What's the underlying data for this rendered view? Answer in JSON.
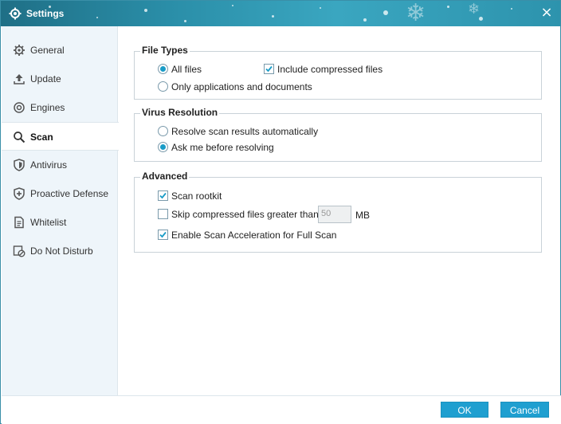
{
  "window": {
    "title": "Settings",
    "close_label": "×"
  },
  "sidebar": {
    "items": [
      {
        "label": "General",
        "icon": "gear-icon",
        "active": false
      },
      {
        "label": "Update",
        "icon": "upload-icon",
        "active": false
      },
      {
        "label": "Engines",
        "icon": "engine-icon",
        "active": false
      },
      {
        "label": "Scan",
        "icon": "search-icon",
        "active": true
      },
      {
        "label": "Antivirus",
        "icon": "shield-icon",
        "active": false
      },
      {
        "label": "Proactive Defense",
        "icon": "shield-plus-icon",
        "active": false
      },
      {
        "label": "Whitelist",
        "icon": "document-icon",
        "active": false
      },
      {
        "label": "Do Not Disturb",
        "icon": "do-not-disturb-icon",
        "active": false
      }
    ]
  },
  "file_types": {
    "title": "File Types",
    "all_files": {
      "label": "All files",
      "selected": true
    },
    "include_compressed": {
      "label": "Include compressed files",
      "checked": true
    },
    "apps_docs": {
      "label": "Only applications and documents",
      "selected": false
    }
  },
  "virus_resolution": {
    "title": "Virus Resolution",
    "auto": {
      "label": "Resolve scan results automatically",
      "selected": false
    },
    "ask": {
      "label": "Ask me before resolving",
      "selected": true
    }
  },
  "advanced": {
    "title": "Advanced",
    "rootkit": {
      "label": "Scan rootkit",
      "checked": true
    },
    "skip_compressed": {
      "label": "Skip compressed files greater than",
      "checked": false,
      "value": "50",
      "unit": "MB"
    },
    "acceleration": {
      "label": "Enable Scan Acceleration for Full Scan",
      "checked": true
    }
  },
  "footer": {
    "ok_label": "OK",
    "cancel_label": "Cancel"
  },
  "colors": {
    "accent": "#1f9fd0",
    "titlebar": "#2a8ea8",
    "sidebar_bg": "#eef5fa"
  }
}
